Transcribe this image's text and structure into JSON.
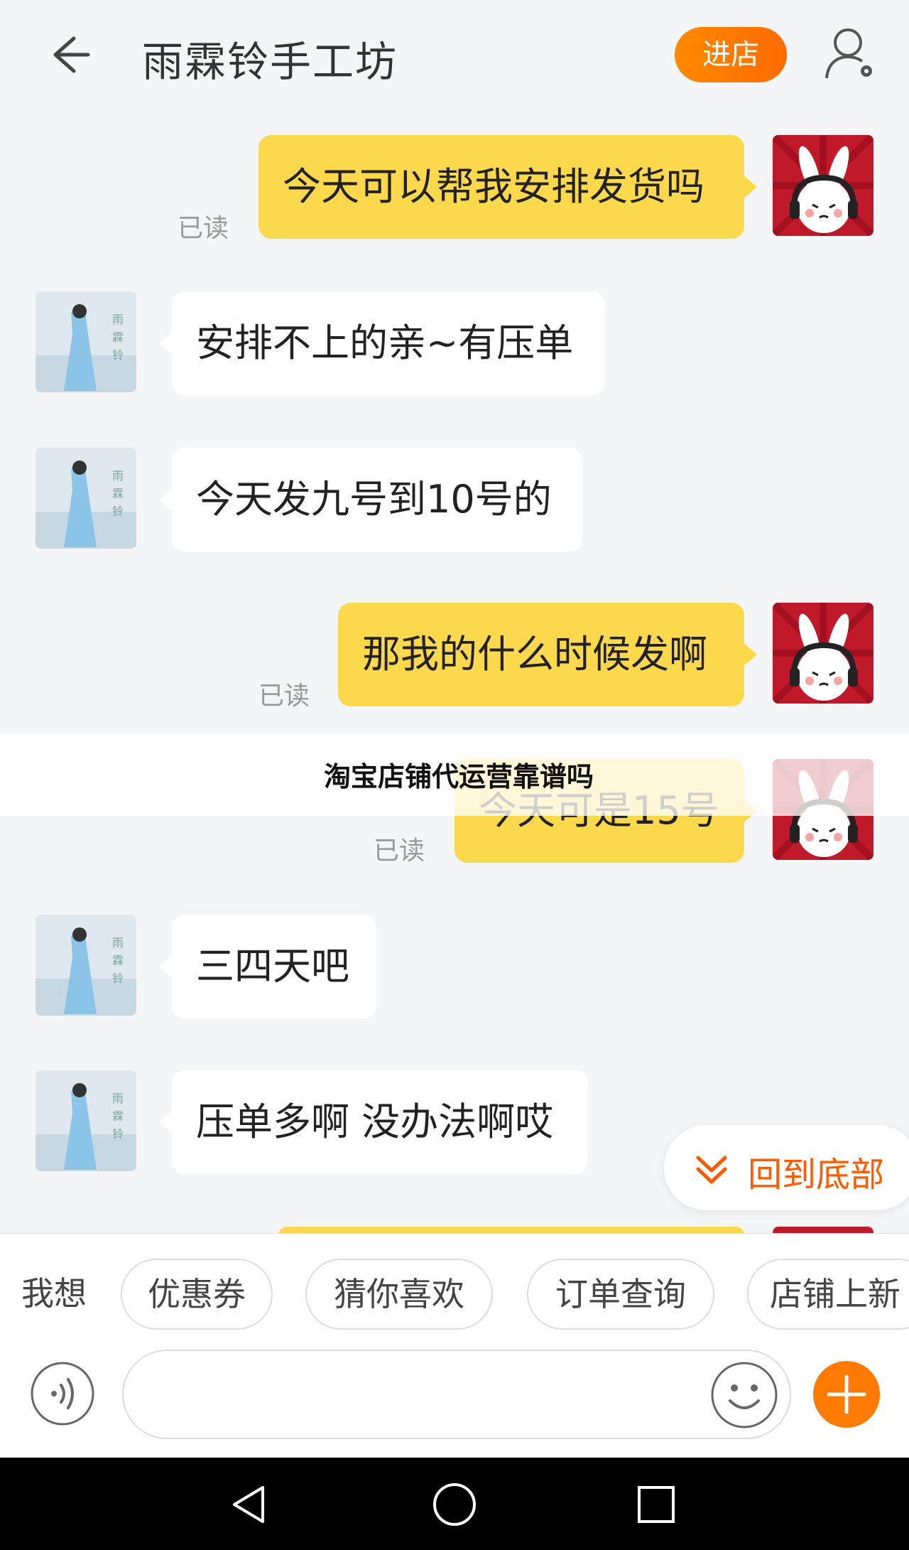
{
  "header": {
    "title": "雨霖铃手工坊",
    "shop_button": "进店"
  },
  "messages": [
    {
      "from": "me",
      "text": "今天可以帮我安排发货吗",
      "status": "已读"
    },
    {
      "from": "them",
      "text": "安排不上的亲~有压单"
    },
    {
      "from": "them",
      "text": "今天发九号到10号的"
    },
    {
      "from": "me",
      "text": "那我的什么时候发啊",
      "status": "已读"
    },
    {
      "from": "me",
      "text": "今天可是15号",
      "status": "已读"
    },
    {
      "from": "them",
      "text": "三四天吧"
    },
    {
      "from": "them",
      "text": "压单多啊 没办法啊哎"
    }
  ],
  "overlay_caption": "淘宝店铺代运营靠谱吗",
  "scroll_to_bottom_label": "回到底部",
  "quick_replies": {
    "label": "我想",
    "chips": [
      "优惠券",
      "猜你喜欢",
      "订单查询",
      "店铺上新"
    ]
  },
  "colors": {
    "accent": "#ff6a00",
    "my_bubble": "#fcd84c",
    "their_bubble": "#ffffff",
    "background": "#f4f5f7"
  },
  "icons": [
    "back-arrow-icon",
    "user-settings-icon",
    "voice-icon",
    "emoji-icon",
    "plus-icon",
    "chevron-down-double-icon",
    "nav-back-icon",
    "nav-home-icon",
    "nav-recent-icon"
  ]
}
